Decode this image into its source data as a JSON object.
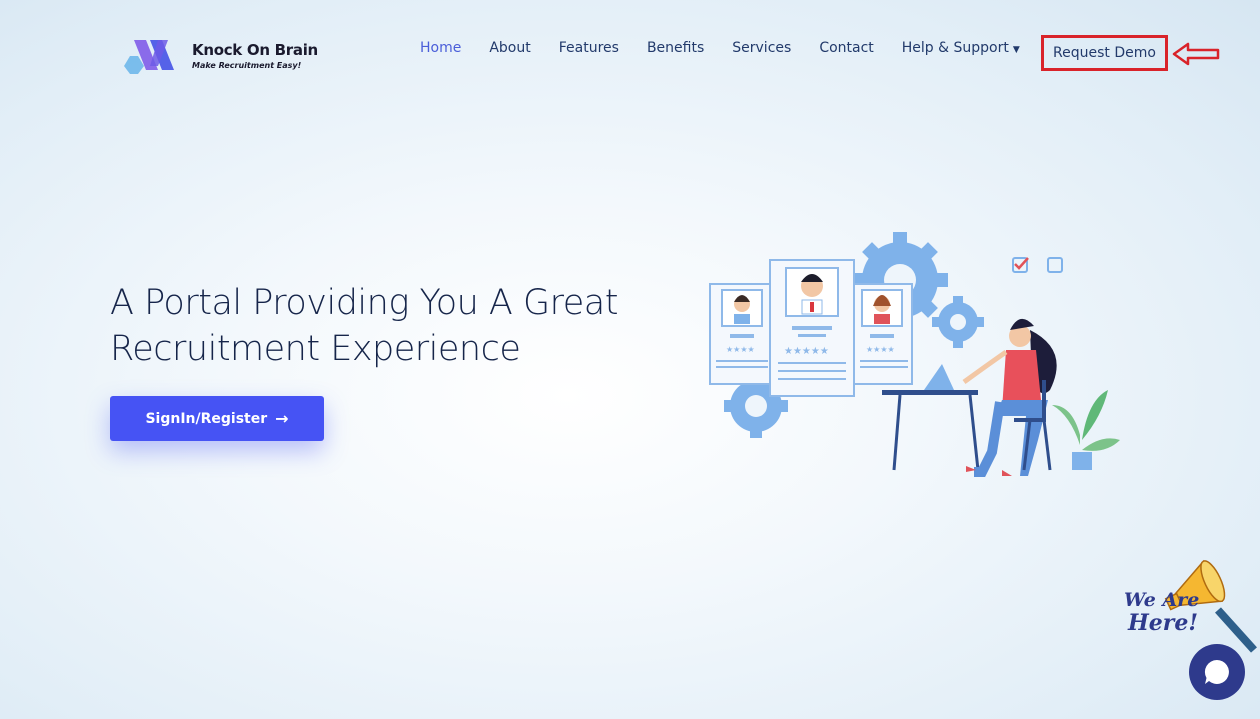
{
  "brand": {
    "name": "Knock On Brain",
    "tagline": "Make Recruitment Easy!",
    "colors": {
      "purple": "#6d5be6",
      "blue": "#4a5ed9",
      "cyan": "#5fb0e8"
    }
  },
  "nav": {
    "items": [
      {
        "label": "Home",
        "active": true
      },
      {
        "label": "About"
      },
      {
        "label": "Features"
      },
      {
        "label": "Benefits"
      },
      {
        "label": "Services"
      },
      {
        "label": "Contact"
      },
      {
        "label": "Help & Support",
        "dropdown": true
      }
    ],
    "request_demo": "Request Demo",
    "highlight_color": "#d9232a"
  },
  "hero": {
    "title_line1": "A Portal Providing You A Great",
    "title_line2": "Recruitment Experience",
    "cta_label": "SignIn/Register",
    "cta_color": "#4653f4"
  },
  "widget": {
    "text_line1": "We Are",
    "text_line2": "Here!",
    "chat_color": "#2e3a8c"
  },
  "icons": {
    "arrow": "arrow-right-icon",
    "caret": "caret-down-icon",
    "chat": "chat-bubble-icon",
    "megaphone": "megaphone-icon"
  }
}
